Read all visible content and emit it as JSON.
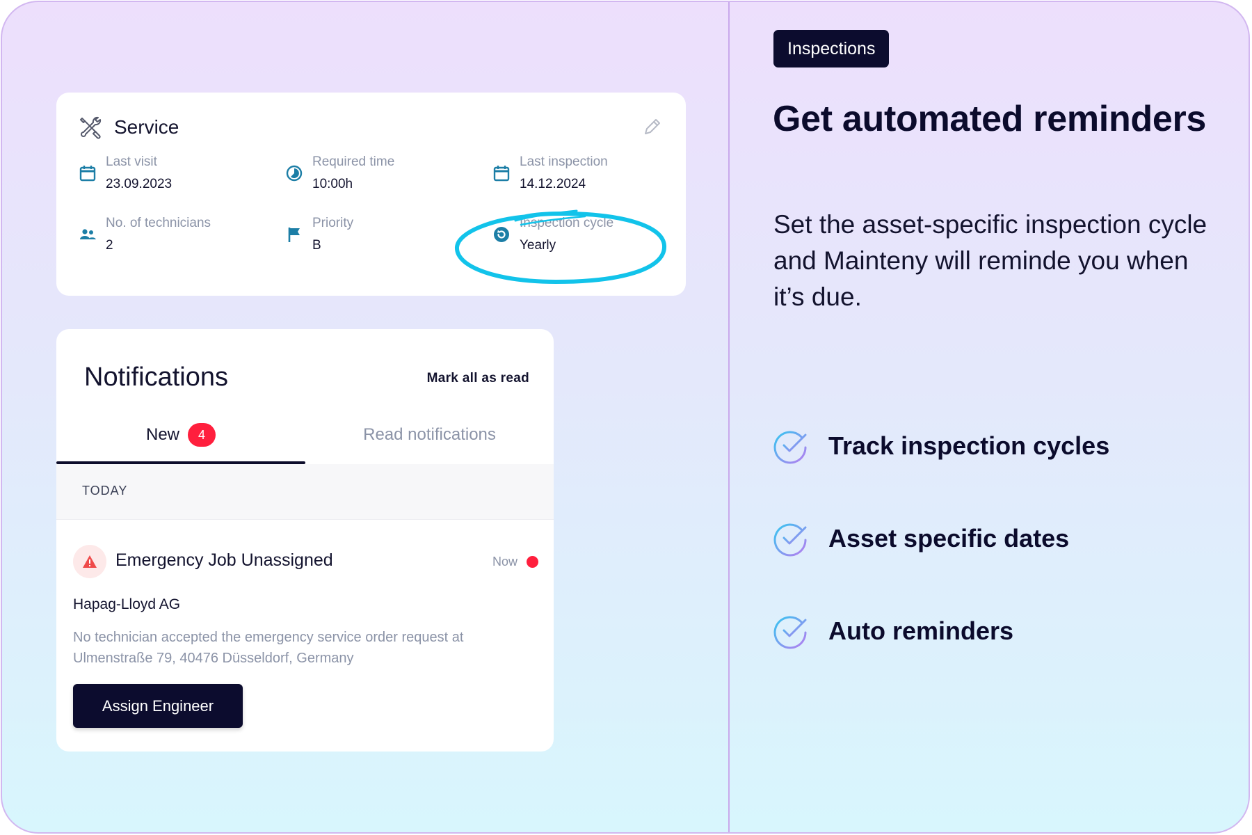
{
  "colors": {
    "accent_dark": "#0c0c2e",
    "badge_red": "#ff1f3d",
    "icon_teal": "#1c7ea6",
    "annotation_cyan": "#12c3ea"
  },
  "service": {
    "title": "Service",
    "title_icon": "tools-icon",
    "fields": [
      {
        "label": "Last visit",
        "value": "23.09.2023",
        "icon": "calendar-icon"
      },
      {
        "label": "Required time",
        "value": "10:00h",
        "icon": "timer-icon"
      },
      {
        "label": "Last inspection",
        "value": "14.12.2024",
        "icon": "calendar-icon"
      },
      {
        "label": "No. of technicians",
        "value": "2",
        "icon": "people-icon"
      },
      {
        "label": "Priority",
        "value": "B",
        "icon": "flag-icon"
      },
      {
        "label": "Inspection cycle",
        "value": "Yearly",
        "icon": "cycle-icon"
      }
    ]
  },
  "notifications": {
    "title": "Notifications",
    "mark_all": "Mark all as read",
    "tabs": [
      {
        "label": "New",
        "badge": "4",
        "active": true
      },
      {
        "label": "Read notifications",
        "active": false
      }
    ],
    "section": "TODAY",
    "item": {
      "title": "Emergency Job Unassigned",
      "time": "Now",
      "company": "Hapag-Lloyd AG",
      "description": "No technician accepted the emergency service order request at Ulmenstraße 79, 40476 Düsseldorf, Germany",
      "action": "Assign Engineer"
    }
  },
  "panel": {
    "tag": "Inspections",
    "headline": "Get automated reminders",
    "description": "Set the asset-specific inspection cycle and Mainteny will reminde you when it’s due.",
    "features": [
      "Track inspection cycles",
      "Asset specific dates",
      "Auto reminders"
    ]
  }
}
